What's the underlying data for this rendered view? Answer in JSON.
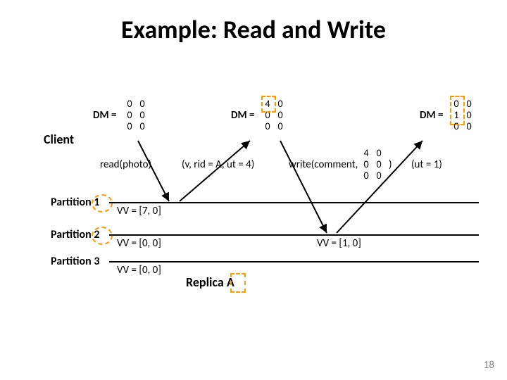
{
  "title": "Example: Read and Write",
  "client_label": "Client",
  "partitions": {
    "p1": {
      "label": "Partition 1",
      "vv": "VV = [7, 0]"
    },
    "p2": {
      "label": "Partition 2",
      "vv": "VV = [0, 0]",
      "vv2": "VV = [1, 0]"
    },
    "p3": {
      "label": "Partition 3",
      "vv": "VV = [0, 0]"
    }
  },
  "dm_label": "DM =",
  "dm1": [
    [
      "0",
      "0"
    ],
    [
      "0",
      "0"
    ],
    [
      "0",
      "0"
    ]
  ],
  "dm2": [
    [
      "4",
      "0"
    ],
    [
      "0",
      "0"
    ],
    [
      "0",
      "0"
    ]
  ],
  "dm3": [
    [
      "0",
      "0"
    ],
    [
      "1",
      "0"
    ],
    [
      "0",
      "0"
    ]
  ],
  "ops": {
    "read": "read(photo)",
    "resp": "(v, rid = A, ut = 4)",
    "write_pre": "write(comment,",
    "write_suf": " )",
    "ut": "(ut = 1)"
  },
  "replica": "Replica A",
  "slide_number": "18"
}
